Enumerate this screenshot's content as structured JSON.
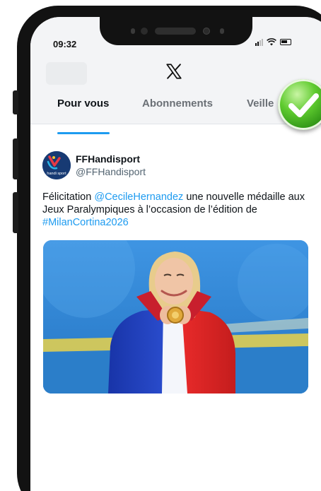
{
  "status_bar": {
    "time": "09:32"
  },
  "header": {
    "logo": "x-logo-icon"
  },
  "tabs": [
    {
      "label": "Pour vous",
      "active": true
    },
    {
      "label": "Abonnements",
      "active": false
    },
    {
      "label": "Veille",
      "active": false
    }
  ],
  "post": {
    "author": {
      "name": "FFHandisport",
      "handle": "@FFHandisport",
      "avatar_text": "handi sport"
    },
    "text": {
      "part1": "Félicitation ",
      "mention": "@CecileHernandez",
      "part2": " une nouvelle médaille aux Jeux Paralympiques à l’occasion de l’édition de ",
      "hashtag": "#MilanCortina2026"
    }
  },
  "overlay": {
    "badge": "checkmark-icon"
  },
  "colors": {
    "link": "#1d9bf0",
    "tab_indicator": "#1d9bf0",
    "badge_green": "#4cb52a"
  }
}
